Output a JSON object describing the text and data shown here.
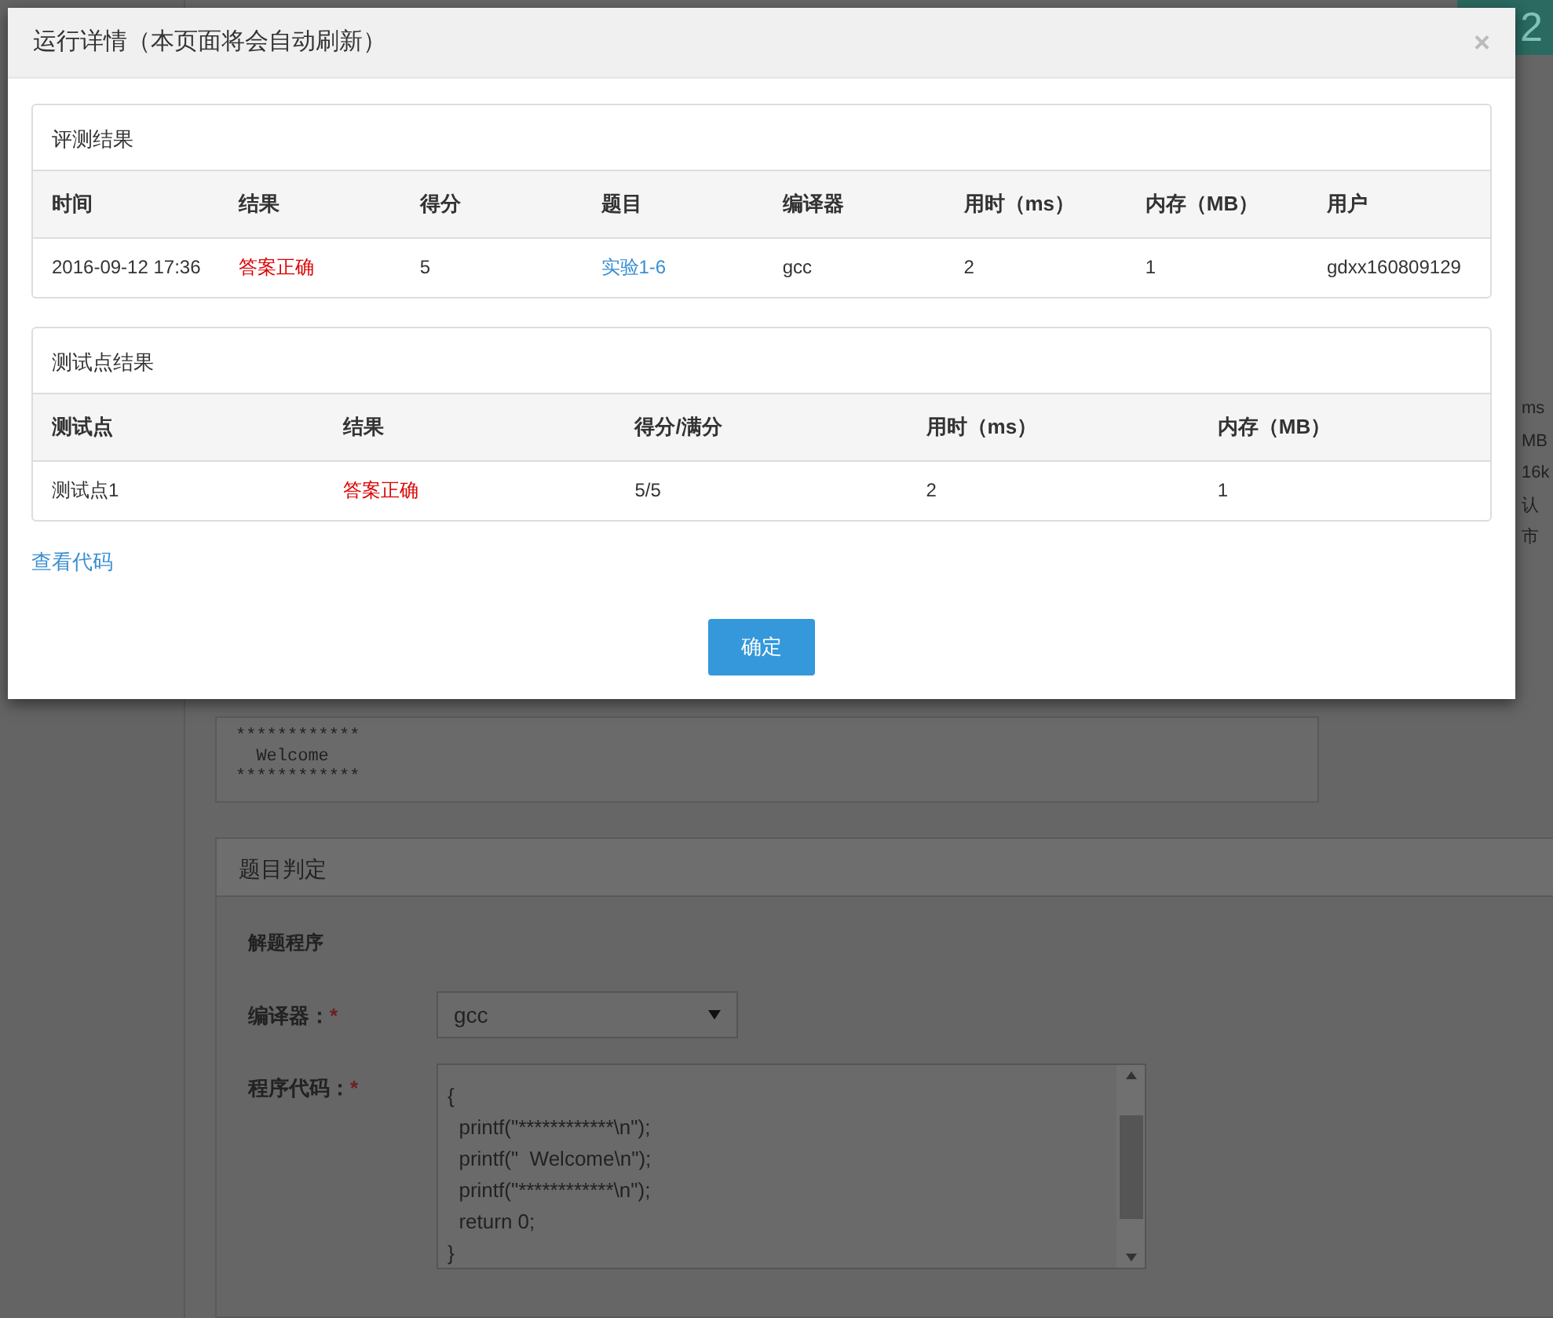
{
  "corner_badge": "2",
  "side_fragments": [
    "ms",
    "MB",
    "16k",
    "认",
    "市"
  ],
  "output_sample": {
    "lines": [
      "************",
      "  Welcome",
      "************"
    ]
  },
  "judge_section": {
    "title": "题目判定",
    "subtitle": "解题程序",
    "fields": [
      {
        "kind": "select",
        "label": "编译器：",
        "required_mark": "*",
        "value": "gcc"
      },
      {
        "kind": "code",
        "label": "程序代码：",
        "required_mark": "*",
        "lines": [
          "{",
          "  printf(\"************\\n\");",
          "  printf(\"  Welcome\\n\");",
          "  printf(\"************\\n\");",
          "  return 0;",
          "}"
        ]
      }
    ]
  },
  "modal": {
    "title": "运行详情（本页面将会自动刷新）",
    "close": "×",
    "panels": [
      {
        "title": "评测结果",
        "columns": [
          {
            "label": "时间",
            "kind": "text"
          },
          {
            "label": "结果",
            "kind": "status"
          },
          {
            "label": "得分",
            "kind": "text"
          },
          {
            "label": "题目",
            "kind": "link"
          },
          {
            "label": "编译器",
            "kind": "text"
          },
          {
            "label": "用时（ms）",
            "kind": "text"
          },
          {
            "label": "内存（MB）",
            "kind": "text"
          },
          {
            "label": "用户",
            "kind": "text"
          }
        ],
        "rows": [
          [
            "2016-09-12 17:36",
            "答案正确",
            "5",
            "实验1-6",
            "gcc",
            "2",
            "1",
            "gdxx160809129"
          ]
        ]
      },
      {
        "title": "测试点结果",
        "columns": [
          {
            "label": "测试点",
            "kind": "text"
          },
          {
            "label": "结果",
            "kind": "status"
          },
          {
            "label": "得分/满分",
            "kind": "text"
          },
          {
            "label": "用时（ms）",
            "kind": "text"
          },
          {
            "label": "内存（MB）",
            "kind": "text"
          }
        ],
        "rows": [
          [
            "测试点1",
            "答案正确",
            "5/5",
            "2",
            "1"
          ]
        ]
      }
    ],
    "link": "查看代码",
    "button": "确定"
  }
}
